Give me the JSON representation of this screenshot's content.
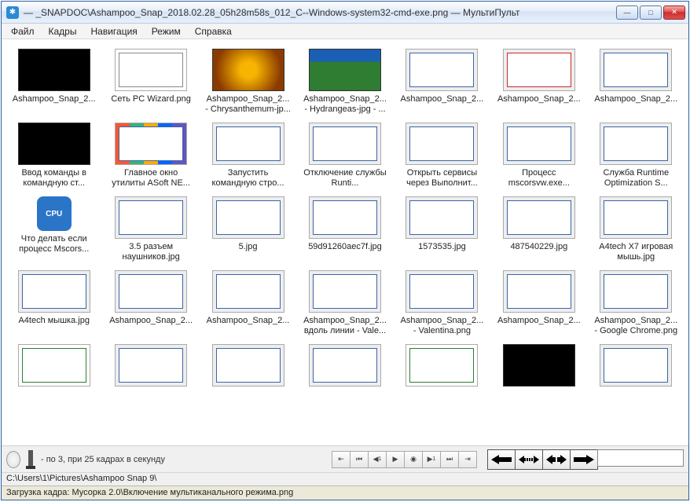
{
  "window": {
    "title": "— _SNAPDOC\\Ashampoo_Snap_2018.02.28_05h28m58s_012_C--Windows-system32-cmd-exe.png — МультиПульт"
  },
  "menu": [
    "Файл",
    "Кадры",
    "Навигация",
    "Режим",
    "Справка"
  ],
  "items": [
    {
      "label": "Ashampoo_Snap_2...",
      "style": "th-black"
    },
    {
      "label": "Сеть PC Wizard.png",
      "style": "th-dark"
    },
    {
      "label": "Ashampoo_Snap_2... - Chrysanthemum-jp...",
      "style": "th-photo1"
    },
    {
      "label": "Ashampoo_Snap_2... - Hydrangeas-jpg - ...",
      "style": "th-photo2"
    },
    {
      "label": "Ashampoo_Snap_2...",
      "style": ""
    },
    {
      "label": "Ashampoo_Snap_2...",
      "style": "th-red"
    },
    {
      "label": "Ashampoo_Snap_2...",
      "style": ""
    },
    {
      "label": "Ввод команды в командную ст...",
      "style": "th-black"
    },
    {
      "label": "Главное окно утилиты ASoft NE...",
      "style": "th-colors"
    },
    {
      "label": "Запустить командную стро...",
      "style": ""
    },
    {
      "label": "Отключение службы Runti...",
      "style": ""
    },
    {
      "label": "Открыть сервисы через Выполнит...",
      "style": ""
    },
    {
      "label": "Процесс mscorsvw.exe...",
      "style": ""
    },
    {
      "label": "Служба Runtime Optimization S...",
      "style": ""
    },
    {
      "label": "Что делать если процесс Mscors...",
      "style": "th-cpu"
    },
    {
      "label": "3.5 разъем наушников.jpg",
      "style": ""
    },
    {
      "label": "5.jpg",
      "style": ""
    },
    {
      "label": "59d91260aec7f.jpg",
      "style": ""
    },
    {
      "label": "1573535.jpg",
      "style": ""
    },
    {
      "label": "487540229.jpg",
      "style": ""
    },
    {
      "label": "A4tech X7 игровая мышь.jpg",
      "style": ""
    },
    {
      "label": "A4tech мышка.jpg",
      "style": ""
    },
    {
      "label": "Ashampoo_Snap_2...",
      "style": ""
    },
    {
      "label": "Ashampoo_Snap_2...",
      "style": ""
    },
    {
      "label": "Ashampoo_Snap_2... вдоль линии - Vale...",
      "style": ""
    },
    {
      "label": "Ashampoo_Snap_2... - Valentina.png",
      "style": ""
    },
    {
      "label": "Ashampoo_Snap_2...",
      "style": ""
    },
    {
      "label": "Ashampoo_Snap_2... - Google Chrome.png",
      "style": ""
    },
    {
      "label": "",
      "style": "th-green"
    },
    {
      "label": "",
      "style": ""
    },
    {
      "label": "",
      "style": ""
    },
    {
      "label": "",
      "style": ""
    },
    {
      "label": "",
      "style": "th-green"
    },
    {
      "label": "",
      "style": "th-black"
    },
    {
      "label": "",
      "style": ""
    }
  ],
  "playbar": {
    "text": "- по 3, при 25 кадрах в секунду"
  },
  "path": "C:\\Users\\1\\Pictures\\Ashampoo Snap 9\\",
  "status": "Загрузка кадра: Мусорка 2.0\\Включение мультиканального режима.png"
}
